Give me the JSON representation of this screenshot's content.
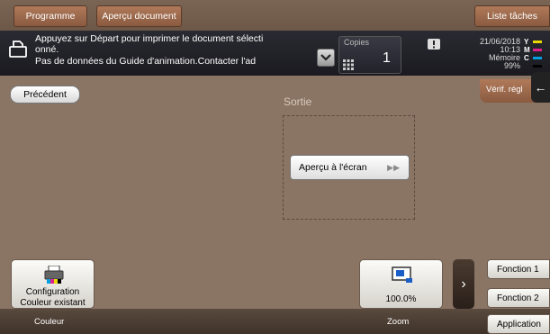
{
  "topbar": {
    "programme": "Programme",
    "apercu_document": "Aperçu document",
    "liste_taches": "Liste tâches"
  },
  "message": {
    "line1": "Appuyez sur Départ pour imprimer le document sélecti",
    "line2": "onné.",
    "line3": "Pas de données du Guide d'animation.Contacter l'ad"
  },
  "copies": {
    "label": "Copies",
    "value": "1"
  },
  "status": {
    "date": "21/06/2018",
    "time": "10:13",
    "memory_label": "Mémoire",
    "memory_value": "99%",
    "toner": [
      {
        "label": "Y",
        "color": "#e8d800"
      },
      {
        "label": "M",
        "color": "#e0208a"
      },
      {
        "label": "C",
        "color": "#00a0e0"
      },
      {
        "label": "K",
        "color": "#000000"
      }
    ]
  },
  "precedent": "Précédent",
  "verif": "Vérif. régl",
  "sortie": {
    "label": "Sortie",
    "apercu_ecran": "Aperçu à l'écran"
  },
  "couleur": {
    "line1": "Configuration",
    "line2": "Couleur existant",
    "label": "Couleur"
  },
  "zoom": {
    "value": "100.0%",
    "label": "Zoom"
  },
  "functions": {
    "fonction1": "Fonction 1",
    "fonction2": "Fonction 2",
    "application": "Application"
  }
}
